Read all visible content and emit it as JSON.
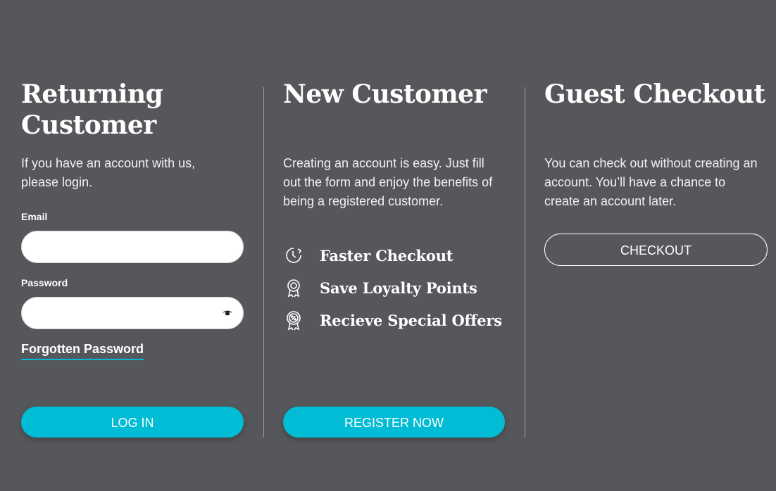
{
  "returning": {
    "title": "Returning Customer",
    "intro": "If you have an account with us, please login.",
    "email_label": "Email",
    "email_value": "",
    "password_label": "Password",
    "password_value": "",
    "forgot_label": "Forgotten Password",
    "login_label": "LOG IN"
  },
  "new_customer": {
    "title": "New Customer",
    "intro": "Creating an account is easy. Just fill out the form and enjoy the benefits of being a registered customer.",
    "benefits": [
      {
        "icon": "clock-icon",
        "label": "Faster Checkout"
      },
      {
        "icon": "award-badge-icon",
        "label": "Save Loyalty Points"
      },
      {
        "icon": "percent-badge-icon",
        "label": "Recieve Special Offers"
      }
    ],
    "register_label": "REGISTER NOW"
  },
  "guest": {
    "title": "Guest Checkout",
    "intro": "You can check out without creating an account. You’ll have a chance to create an account later.",
    "checkout_label": "CHECKOUT"
  },
  "colors": {
    "background": "#55575b",
    "accent": "#00bcd4",
    "text": "#ffffff"
  }
}
